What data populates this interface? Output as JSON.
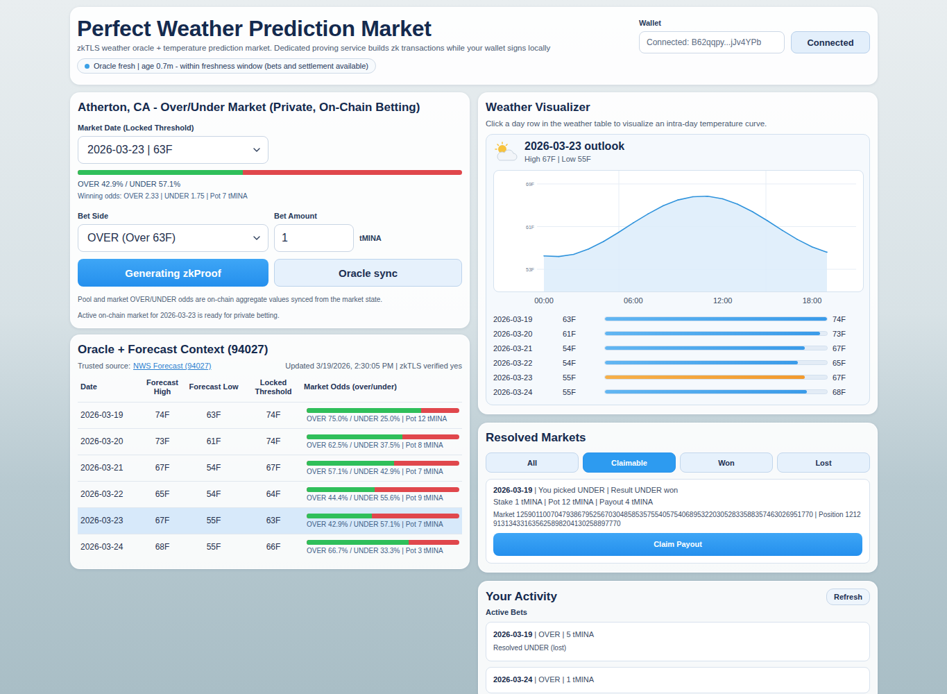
{
  "header": {
    "title": "Perfect Weather Prediction Market",
    "subtitle": "zkTLS weather oracle + temperature prediction market. Dedicated proving service builds zk transactions while your wallet signs locally",
    "oracle_badge": "Oracle fresh | age 0.7m - within freshness window (bets and settlement available)",
    "oracle_fresh": true
  },
  "wallet": {
    "label": "Wallet",
    "value": "Connected: B62qqpy...jJv4YPb",
    "button": "Connected"
  },
  "market": {
    "title": "Atherton, CA - Over/Under Market (Private, On-Chain Betting)",
    "date_label": "Market Date (Locked Threshold)",
    "date_value": "2026-03-23 | 63F",
    "over_level": 0.429,
    "odds_text": "OVER 42.9% / UNDER 57.1%",
    "winning_odds": "Winning odds: OVER 2.33 | UNDER 1.75 | Pot 7 tMINA",
    "bet_side_label": "Bet Side",
    "bet_side_value": "OVER (Over 63F)",
    "bet_amount_label": "Bet Amount",
    "bet_amount_value": "1",
    "unit": "tMINA",
    "primary_button": "Generating zkProof",
    "secondary_button": "Oracle sync",
    "notes": [
      "Pool and market OVER/UNDER odds are on-chain aggregate values synced from the market state.",
      "Active on-chain market for 2026-03-23 is ready for private betting."
    ]
  },
  "oracle": {
    "title": "Oracle + Forecast Context (94027)",
    "source_label": "Trusted source:",
    "source_link": "NWS Forecast (94027)",
    "updated": "Updated 3/19/2026, 2:30:05 PM | zkTLS verified yes",
    "columns": [
      "Date",
      "Forecast High",
      "Forecast Low",
      "Locked Threshold",
      "Market Odds (over/under)"
    ],
    "rows": [
      {
        "date": "2026-03-19",
        "high": "74F",
        "low": "63F",
        "threshold": "74F",
        "over_level": 0.75,
        "odds": "OVER 75.0% / UNDER 25.0% | Pot 12 tMINA",
        "selected": false
      },
      {
        "date": "2026-03-20",
        "high": "73F",
        "low": "61F",
        "threshold": "74F",
        "over_level": 0.625,
        "odds": "OVER 62.5% / UNDER 37.5% | Pot 8 tMINA",
        "selected": false
      },
      {
        "date": "2026-03-21",
        "high": "67F",
        "low": "54F",
        "threshold": "67F",
        "over_level": 0.571,
        "odds": "OVER 57.1% / UNDER 42.9% | Pot 7 tMINA",
        "selected": false
      },
      {
        "date": "2026-03-22",
        "high": "65F",
        "low": "54F",
        "threshold": "64F",
        "over_level": 0.444,
        "odds": "OVER 44.4% / UNDER 55.6% | Pot 9 tMINA",
        "selected": false
      },
      {
        "date": "2026-03-23",
        "high": "67F",
        "low": "55F",
        "threshold": "63F",
        "over_level": 0.429,
        "odds": "OVER 42.9% / UNDER 57.1% | Pot 7 tMINA",
        "selected": true
      },
      {
        "date": "2026-03-24",
        "high": "68F",
        "low": "55F",
        "threshold": "66F",
        "over_level": 0.667,
        "odds": "OVER 66.7% / UNDER 33.3% | Pot 3 tMINA",
        "selected": false
      }
    ]
  },
  "visualizer": {
    "title": "Weather Visualizer",
    "hint": "Click a day row in the weather table to visualize an intra-day temperature curve.",
    "day_title": "2026-03-23 outlook",
    "day_sub": "High 67F | Low 55F",
    "chart": {
      "y_min": 53,
      "y_max": 69,
      "y_ticks": [
        "69F",
        "61F",
        "53F"
      ],
      "x_ticks": [
        "00:00",
        "06:00",
        "12:00",
        "18:00"
      ],
      "series": [
        55.5,
        55.4,
        55.8,
        56.8,
        58.2,
        59.9,
        61.7,
        63.4,
        64.9,
        66.0,
        66.6,
        66.7,
        66.2,
        65.2,
        63.8,
        62.1,
        60.3,
        58.6,
        57.2,
        56.2
      ]
    },
    "days": [
      {
        "date": "2026-03-19",
        "low": "63F",
        "high": "74F",
        "level": 1.0,
        "selected": false
      },
      {
        "date": "2026-03-20",
        "low": "61F",
        "high": "73F",
        "level": 0.97,
        "selected": false
      },
      {
        "date": "2026-03-21",
        "low": "54F",
        "high": "67F",
        "level": 0.9,
        "selected": false
      },
      {
        "date": "2026-03-22",
        "low": "54F",
        "high": "65F",
        "level": 0.87,
        "selected": false
      },
      {
        "date": "2026-03-23",
        "low": "55F",
        "high": "67F",
        "level": 0.9,
        "selected": true
      },
      {
        "date": "2026-03-24",
        "low": "55F",
        "high": "68F",
        "level": 0.91,
        "selected": false
      }
    ]
  },
  "resolved": {
    "title": "Resolved Markets",
    "tabs": [
      {
        "label": "All",
        "selected": false
      },
      {
        "label": "Claimable",
        "selected": true
      },
      {
        "label": "Won",
        "selected": false
      },
      {
        "label": "Lost",
        "selected": false
      }
    ],
    "items": [
      {
        "date": "2026-03-19",
        "summary": "| You picked UNDER | Result UNDER won",
        "stake": "Stake 1 tMINA | Pot 12 tMINA | Payout 4 tMINA",
        "market": "Market 12590110070479386795256703048585357554057540689532203052833588357463026951770 | Position 1212913134331635625898204130258897770",
        "button": "Claim Payout"
      }
    ]
  },
  "activity": {
    "title": "Your Activity",
    "refresh": "Refresh",
    "section": "Active Bets",
    "items": [
      {
        "date": "2026-03-19",
        "summary": "| OVER | 5 tMINA",
        "sub": "Resolved UNDER (lost)"
      },
      {
        "date": "2026-03-24",
        "summary": "| OVER | 1 tMINA",
        "sub": ""
      }
    ]
  }
}
